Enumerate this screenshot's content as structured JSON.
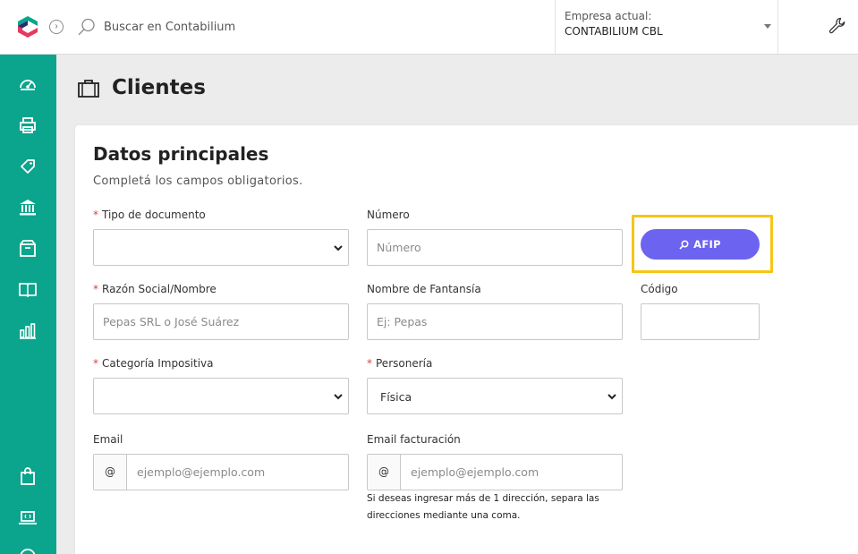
{
  "header": {
    "search_placeholder": "Buscar en Contabilium",
    "company_label": "Empresa actual:",
    "company_name": "CONTABILIUM CBL"
  },
  "brand": {
    "accent": "#0aa58c",
    "primary_button": "#6c63f0",
    "highlight": "#f5c518"
  },
  "sidebar": {
    "items": [
      {
        "icon": "dashboard-icon"
      },
      {
        "icon": "printer-icon"
      },
      {
        "icon": "tag-icon"
      },
      {
        "icon": "bank-icon"
      },
      {
        "icon": "box-icon"
      },
      {
        "icon": "book-icon"
      },
      {
        "icon": "bar-chart-icon"
      },
      {
        "icon": "shopping-bag-icon"
      },
      {
        "icon": "laptop-icon"
      },
      {
        "icon": "help-icon"
      }
    ]
  },
  "page": {
    "title": "Clientes"
  },
  "form": {
    "title": "Datos principales",
    "subtitle": "Completá los campos obligatorios.",
    "required_mark": "*",
    "tipo_documento": {
      "label": "Tipo de documento",
      "value": ""
    },
    "numero": {
      "label": "Número",
      "placeholder": "Número"
    },
    "afip_button": "AFIP",
    "razon_social": {
      "label": "Razón Social/Nombre",
      "placeholder": "Pepas SRL o José Suárez"
    },
    "nombre_fantasia": {
      "label": "Nombre de Fantansía",
      "placeholder": "Ej: Pepas"
    },
    "codigo": {
      "label": "Código",
      "placeholder": ""
    },
    "categoria_impositiva": {
      "label": "Categoría Impositiva",
      "value": ""
    },
    "personeria": {
      "label": "Personería",
      "value": "Física"
    },
    "email": {
      "label": "Email",
      "prefix": "@",
      "placeholder": "ejemplo@ejemplo.com"
    },
    "email_facturacion": {
      "label": "Email facturación",
      "prefix": "@",
      "placeholder": "ejemplo@ejemplo.com"
    },
    "email_help_line1": "Si deseas ingresar más de 1 dirección, separa las",
    "email_help_line2": "direcciones mediante una coma."
  }
}
